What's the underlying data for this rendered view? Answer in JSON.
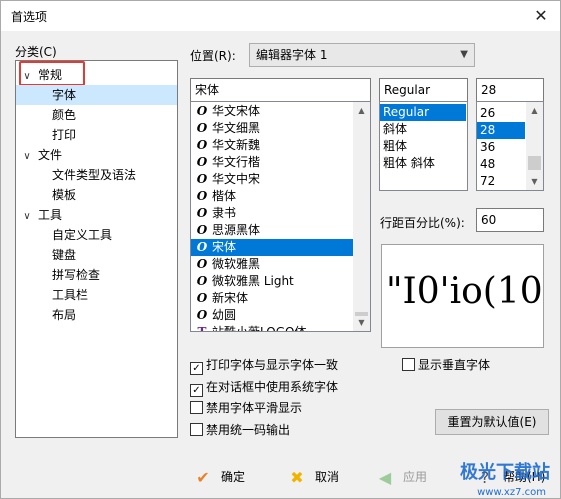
{
  "window": {
    "title": "首选项",
    "close_glyph": "✕"
  },
  "category_label": "分类(C)",
  "tree": [
    {
      "label": "常规",
      "level": 0,
      "expanded": true
    },
    {
      "label": "字体",
      "level": 1,
      "selected": true
    },
    {
      "label": "颜色",
      "level": 1
    },
    {
      "label": "打印",
      "level": 1
    },
    {
      "label": "文件",
      "level": 0,
      "expanded": true
    },
    {
      "label": "文件类型及语法",
      "level": 1
    },
    {
      "label": "模板",
      "level": 1
    },
    {
      "label": "工具",
      "level": 0,
      "expanded": true
    },
    {
      "label": "自定义工具",
      "level": 1
    },
    {
      "label": "键盘",
      "level": 1
    },
    {
      "label": "拼写检查",
      "level": 1
    },
    {
      "label": "工具栏",
      "level": 1
    },
    {
      "label": "布局",
      "level": 1
    }
  ],
  "position": {
    "label": "位置(R):",
    "value": "编辑器字体 1"
  },
  "font_name": {
    "value": "宋体"
  },
  "font_list": [
    {
      "name": "华文宋体",
      "icon": "O"
    },
    {
      "name": "华文细黑",
      "icon": "O"
    },
    {
      "name": "华文新魏",
      "icon": "O"
    },
    {
      "name": "华文行楷",
      "icon": "O"
    },
    {
      "name": "华文中宋",
      "icon": "O"
    },
    {
      "name": "楷体",
      "icon": "O"
    },
    {
      "name": "隶书",
      "icon": "O"
    },
    {
      "name": "思源黑体",
      "icon": "O"
    },
    {
      "name": "宋体",
      "icon": "O",
      "selected": true
    },
    {
      "name": "微软雅黑",
      "icon": "O"
    },
    {
      "name": "微软雅黑 Light",
      "icon": "O"
    },
    {
      "name": "新宋体",
      "icon": "O"
    },
    {
      "name": "幼圆",
      "icon": "O"
    },
    {
      "name": "站酷小薇LOGO体",
      "icon": "T"
    }
  ],
  "style": {
    "value": "Regular",
    "options": [
      {
        "label": "Regular",
        "selected": true
      },
      {
        "label": "斜体"
      },
      {
        "label": "粗体"
      },
      {
        "label": "粗体 斜体"
      }
    ]
  },
  "size": {
    "value": "28",
    "options": [
      {
        "label": "26"
      },
      {
        "label": "28",
        "selected": true
      },
      {
        "label": "36"
      },
      {
        "label": "48"
      },
      {
        "label": "72"
      }
    ]
  },
  "line_spacing": {
    "label": "行距百分比(%):",
    "value": "60"
  },
  "preview_text": "\"I0'io(10",
  "checkboxes": {
    "print_font": {
      "label": "打印字体与显示字体一致",
      "checked": true
    },
    "system_font": {
      "label": "在对话框中使用系统字体",
      "checked": true
    },
    "no_smoothing": {
      "label": "禁用字体平滑显示",
      "checked": false
    },
    "no_unicode": {
      "label": "禁用统一码输出",
      "checked": false
    },
    "vertical_font": {
      "label": "显示垂直字体",
      "checked": false
    }
  },
  "reset_button": "重置为默认值(E)",
  "bottom": {
    "ok": "确定",
    "cancel": "取消",
    "apply": "应用",
    "help": "帮助(H)"
  },
  "watermark": {
    "main": "极光下载站",
    "sub": "www.xz7.com"
  },
  "colors": {
    "selection": "#0078d7",
    "tree_selection": "#cce8ff",
    "highlight_box": "#e53935",
    "ok_icon": "#e8832a",
    "cancel_icon": "#f0b400"
  }
}
